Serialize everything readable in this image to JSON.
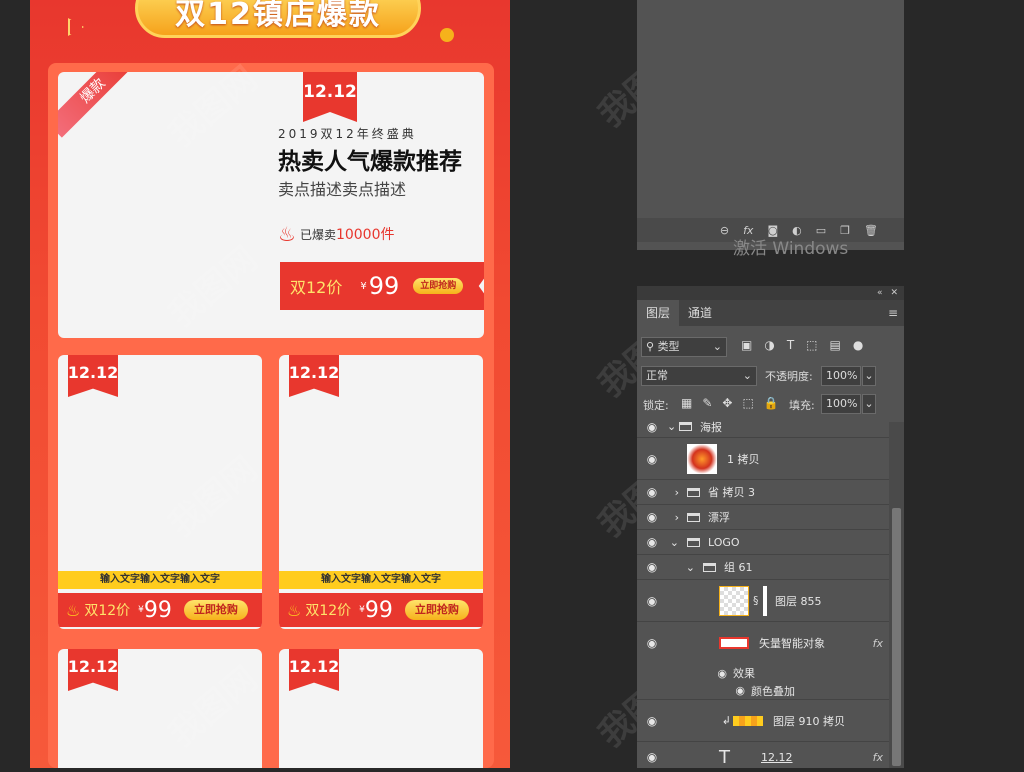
{
  "poster": {
    "title": "双12镇店爆款",
    "hero": {
      "badge": "12.12",
      "corner": "爆款",
      "subtitle": "2019双12年终盛典",
      "title": "热卖人气爆款推荐",
      "desc": "卖点描述卖点描述",
      "sold_prefix": "已爆卖",
      "sold_count": "10000件",
      "price_label": "双12价",
      "currency": "¥",
      "price": "99",
      "buy": "立即抢购"
    },
    "products": [
      {
        "badge": "12.12",
        "text": "输入文字输入文字输入文字",
        "price_label": "双12价",
        "currency": "¥",
        "price": "99",
        "buy": "立即抢购"
      },
      {
        "badge": "12.12",
        "text": "输入文字输入文字输入文字",
        "price_label": "双12价",
        "currency": "¥",
        "price": "99",
        "buy": "立即抢购"
      },
      {
        "badge": "12.12"
      },
      {
        "badge": "12.12"
      }
    ],
    "watermark": "我图网"
  },
  "top_panel": {
    "activate_text": "激活 Windows",
    "toolbar_icons": [
      "link-icon",
      "fx-icon",
      "mask-icon",
      "adjustment-icon",
      "folder-icon",
      "new-layer-icon",
      "trash-icon"
    ]
  },
  "layers_panel": {
    "tabs": [
      "图层",
      "通道"
    ],
    "filter_label": "类型",
    "blend_mode": "正常",
    "opacity_label": "不透明度:",
    "opacity_value": "100%",
    "lock_label": "锁定:",
    "fill_label": "填充:",
    "fill_value": "100%",
    "layers": [
      {
        "name": "海报",
        "kind": "folder",
        "expanded": true
      },
      {
        "name": "1 拷贝",
        "kind": "image"
      },
      {
        "name": "省 拷贝 3",
        "kind": "folder",
        "expanded": false
      },
      {
        "name": "漂浮",
        "kind": "folder",
        "expanded": false
      },
      {
        "name": "LOGO",
        "kind": "folder",
        "expanded": true
      },
      {
        "name": "组 61",
        "kind": "folder",
        "expanded": true
      },
      {
        "name": "图层 855",
        "kind": "image"
      },
      {
        "name": "矢量智能对象",
        "kind": "smart",
        "fx": "fx"
      },
      {
        "name": "效果",
        "kind": "effect"
      },
      {
        "name": "颜色叠加",
        "kind": "effect"
      },
      {
        "name": "图层 910 拷贝",
        "kind": "image"
      },
      {
        "name": "12.12",
        "kind": "text",
        "fx": "fx"
      }
    ]
  }
}
